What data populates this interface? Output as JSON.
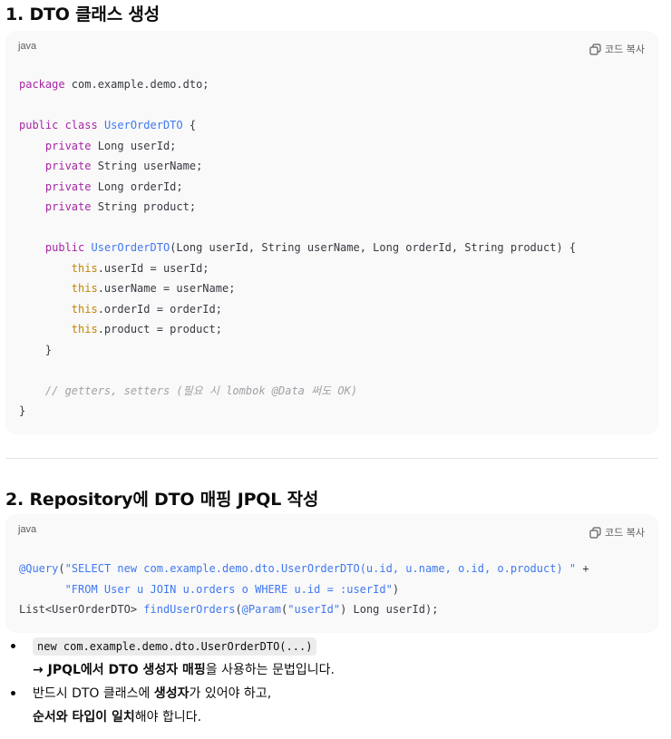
{
  "section1": {
    "heading": "1. DTO 클래스 생성",
    "lang": "java",
    "copy_label": "코드 복사",
    "code": {
      "l1_kw": "package",
      "l1_rest": " com.example.demo.dto;",
      "l3_kw": "public class",
      "l3_cls": "UserOrderDTO",
      "l3_rest": " {",
      "fields": [
        {
          "kw": "private",
          "rest": " Long userId;"
        },
        {
          "kw": "private",
          "rest": " String userName;"
        },
        {
          "kw": "private",
          "rest": " Long orderId;"
        },
        {
          "kw": "private",
          "rest": " String product;"
        }
      ],
      "ctor_kw": "public",
      "ctor_cls": "UserOrderDTO",
      "ctor_rest": "(Long userId, String userName, Long orderId, String product) {",
      "assigns": [
        {
          "ths": "this",
          "rest": ".userId = userId;"
        },
        {
          "ths": "this",
          "rest": ".userName = userName;"
        },
        {
          "ths": "this",
          "rest": ".orderId = orderId;"
        },
        {
          "ths": "this",
          "rest": ".product = product;"
        }
      ],
      "ctor_close": "}",
      "comment": "// getters, setters (필요 시 lombok @Data 써도 OK)",
      "class_close": "}"
    }
  },
  "section2": {
    "heading": "2. Repository에 DTO 매핑 JPQL 작성",
    "lang": "java",
    "copy_label": "코드 복사",
    "code": {
      "ann": "@Query",
      "paren_open": "(",
      "str1": "\"SELECT new com.example.demo.dto.UserOrderDTO(u.id, u.name, o.id, o.product) \"",
      "plus": " +",
      "str2": "\"FROM User u JOIN u.orders o WHERE u.id = :userId\"",
      "paren_close": ")",
      "l3_a": "List<UserOrderDTO> ",
      "l3_method": "findUserOrders",
      "l3_b": "(",
      "l3_ann": "@Param",
      "l3_c": "(",
      "l3_str": "\"userId\"",
      "l3_d": ") Long userId);"
    }
  },
  "notes": {
    "n1_code": "new com.example.demo.dto.UserOrderDTO(...)",
    "n1_arrow": "→ JPQL에서 DTO 생성자 매핑",
    "n1_rest": "을 사용하는 문법입니다.",
    "n2_a": "반드시 DTO 클래스에 ",
    "n2_bold": "생성자",
    "n2_b": "가 있어야 하고,",
    "n2_bold2": "순서와 타입이 일치",
    "n2_c": "해야 합니다."
  }
}
